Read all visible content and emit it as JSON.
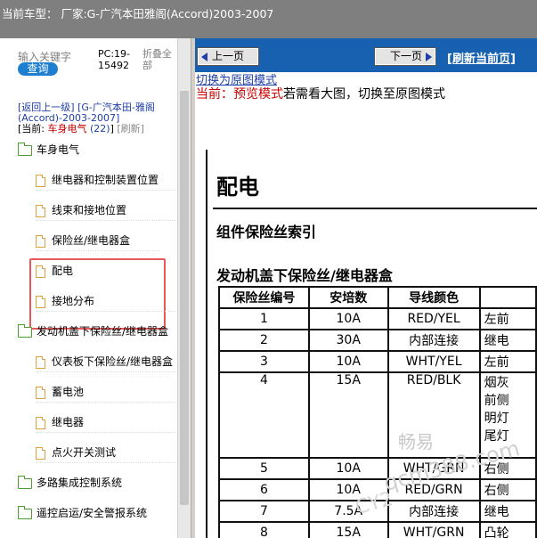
{
  "header": {
    "title": "当前车型：  厂家:G-广汽本田雅阁(Accord)2003-2007"
  },
  "sidebar": {
    "keyword_placeholder": "输入关键字",
    "search_label": "查询",
    "pc_label": "PC:19-15492",
    "fold_label": "折叠全部",
    "back_label": "[返回上一级]  [G-广汽本田-雅阁(Accord)-2003-2007]",
    "current_prefix": "[当前: ",
    "current_value": "车身电气",
    "current_count": "(22)",
    "current_suffix": "]",
    "refresh_label": "[刷新]",
    "items": [
      {
        "label": "车身电气",
        "type": "folder"
      },
      {
        "label": "继电器和控制装置位置",
        "type": "doc"
      },
      {
        "label": "线束和接地位置",
        "type": "doc"
      },
      {
        "label": "保险丝/继电器盒",
        "type": "doc"
      },
      {
        "label": "配电",
        "type": "doc"
      },
      {
        "label": "接地分布",
        "type": "doc"
      },
      {
        "label": "发动机盖下保险丝/继电器盒",
        "type": "folder"
      },
      {
        "label": "仪表板下保险丝/继电器盒",
        "type": "doc"
      },
      {
        "label": "蓄电池",
        "type": "doc"
      },
      {
        "label": "继电器",
        "type": "doc"
      },
      {
        "label": "点火开关测试",
        "type": "doc"
      },
      {
        "label": "多路集成控制系统",
        "type": "folder"
      },
      {
        "label": "遥控启运/安全警报系统",
        "type": "folder"
      }
    ]
  },
  "content": {
    "prev_label": "上一页",
    "next_label": "下一页",
    "refresh_label": "[刷新当前页]",
    "switch_link": "切换为原图模式",
    "preview_prefix": "当前：预览模式",
    "preview_text": "若需看大图，切换至原图模式",
    "doc": {
      "title": "配电",
      "index_title": "组件保险丝索引",
      "section_title": "发动机盖下保险丝/继电器盒",
      "headers": [
        "保险丝编号",
        "安培数",
        "导线颜色",
        ""
      ],
      "rows": [
        [
          "1",
          "10A",
          "RED/YEL",
          "左前"
        ],
        [
          "2",
          "30A",
          "内部连接",
          "继电"
        ],
        [
          "3",
          "10A",
          "WHT/YEL",
          "左前"
        ],
        [
          "4",
          "15A",
          "RED/BLK",
          "烟灰\n前侧\n明灯\n尾灯"
        ],
        [
          "5",
          "10A",
          "WHT/GRN",
          "右侧"
        ],
        [
          "6",
          "10A",
          "RED/GRN",
          "右侧"
        ],
        [
          "7",
          "7.5A",
          "内部连接",
          "继电"
        ],
        [
          "8",
          "15A",
          "WHT/GRN",
          "凸轮"
        ]
      ],
      "watermark": [
        "畅易",
        "qcm388.com",
        "CY2"
      ]
    }
  }
}
